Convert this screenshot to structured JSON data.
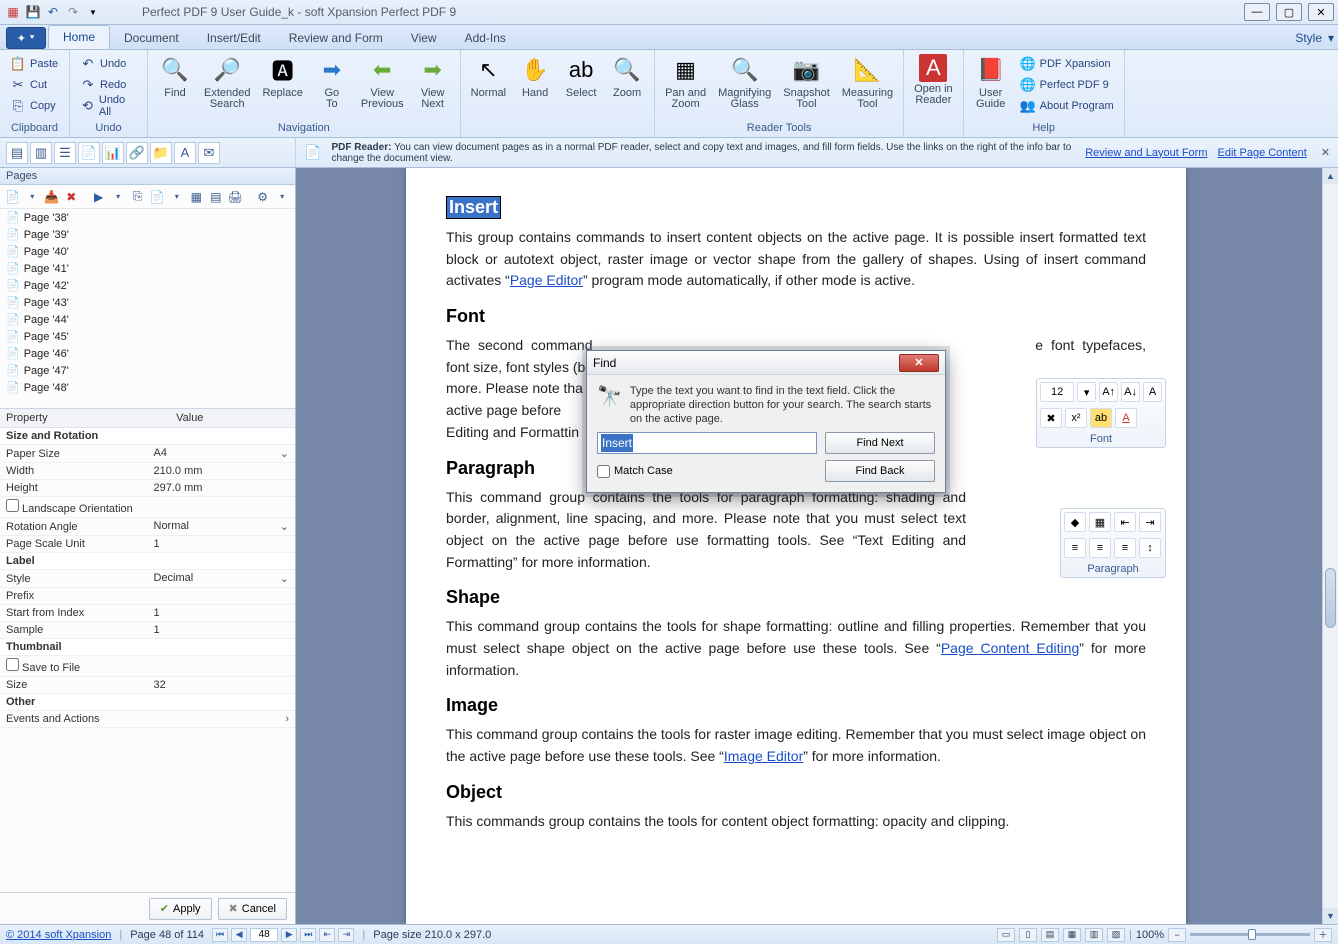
{
  "title": "Perfect PDF 9 User Guide_k - soft Xpansion Perfect PDF 9",
  "tabs": [
    "Home",
    "Document",
    "Insert/Edit",
    "Review and Form",
    "View",
    "Add-Ins"
  ],
  "active_tab": 0,
  "style_menu": "Style",
  "ribbon": {
    "clipboard": {
      "label": "Clipboard",
      "paste": "Paste",
      "cut": "Cut",
      "copy": "Copy"
    },
    "undo": {
      "label": "Undo",
      "undo": "Undo",
      "redo": "Redo",
      "undo_all": "Undo All"
    },
    "navigation": {
      "label": "Navigation",
      "find": "Find",
      "ext": "Extended\nSearch",
      "replace": "Replace",
      "goto": "Go\nTo",
      "vprev": "View\nPrevious",
      "vnext": "View\nNext"
    },
    "tools": {
      "normal": "Normal",
      "hand": "Hand",
      "select": "Select",
      "zoom": "Zoom"
    },
    "reader": {
      "label": "Reader Tools",
      "pan": "Pan and\nZoom",
      "mag": "Magnifying\nGlass",
      "snap": "Snapshot\nTool",
      "meas": "Measuring\nTool"
    },
    "open_reader": "Open in\nReader",
    "user_guide": "User\nGuide",
    "help": {
      "label": "Help",
      "xp": "PDF Xpansion",
      "p9": "Perfect PDF 9",
      "about": "About Program"
    }
  },
  "infobar": {
    "title": "PDF Reader:",
    "text": "You can view document pages as in a normal PDF reader, select and copy text and images, and fill form fields. Use the links on the right of the info bar to change the document view.",
    "link1": "Review and Layout Form",
    "link2": "Edit Page Content"
  },
  "pages_panel": {
    "title": "Pages",
    "items": [
      "Page '38'",
      "Page '39'",
      "Page '40'",
      "Page '41'",
      "Page '42'",
      "Page '43'",
      "Page '44'",
      "Page '45'",
      "Page '46'",
      "Page '47'",
      "Page '48'"
    ]
  },
  "props": {
    "headers": [
      "Property",
      "Value"
    ],
    "groups": [
      {
        "name": "Size and Rotation",
        "rows": [
          [
            "Paper Size",
            "A4",
            "dd"
          ],
          [
            "Width",
            "210.0 mm",
            ""
          ],
          [
            "Height",
            "297.0 mm",
            ""
          ],
          [
            "Landscape Orientation",
            "",
            "chk"
          ],
          [
            "Rotation Angle",
            "Normal",
            "dd"
          ],
          [
            "Page Scale Unit",
            "1",
            ""
          ]
        ]
      },
      {
        "name": "Label",
        "rows": [
          [
            "Style",
            "Decimal",
            "dd"
          ],
          [
            "Prefix",
            "",
            ""
          ],
          [
            "Start from Index",
            "1",
            ""
          ],
          [
            "Sample",
            "1",
            ""
          ]
        ]
      },
      {
        "name": "Thumbnail",
        "rows": [
          [
            "Save to File",
            "",
            "chk"
          ],
          [
            "Size",
            "32",
            ""
          ]
        ]
      },
      {
        "name": "Other",
        "rows": [
          [
            "Events and Actions",
            "",
            "arr"
          ]
        ]
      }
    ],
    "apply": "Apply",
    "cancel": "Cancel"
  },
  "doc": {
    "h1": "Insert",
    "p1a": "This group contains commands to insert content objects on the active page. It is possible insert formatted text block or autotext object, raster image or vector shape from the gallery of shapes. Using of insert command activates “",
    "p1_link": "Page Editor",
    "p1b": "” program mode automatically, if other mode is active.",
    "h2": "Font",
    "p2a": "The second command",
    "p2b": "e font typefaces, font size, font styles (bol",
    "p2c": "more. Please note tha",
    "p2d": "active page before",
    "p2e": "Editing and Formattin",
    "font_box_label": "Font",
    "font_size": "12",
    "h3": "Paragraph",
    "p3": "This command group contains the tools for paragraph formatting: shading and border, alignment, line spacing, and more. Please note that you must select text object on the active page before use formatting tools. See “Text Editing and Formatting” for more information.",
    "para_box_label": "Paragraph",
    "h4": "Shape",
    "p4a": "This command group contains the tools for shape formatting: outline and filling properties. Remember that you must select shape object on the active page before use these tools. See “",
    "p4_link": "Page Content Editing",
    "p4b": "” for more information.",
    "h5": "Image",
    "p5a": "This command group contains the tools for raster image editing. Remember that you must select image object on the active page before use these tools. See “",
    "p5_link": "Image Editor",
    "p5b": "” for more information.",
    "h6": "Object",
    "p6": "This commands group contains the tools for content object formatting: opacity and clipping."
  },
  "dialog": {
    "title": "Find",
    "hint": "Type the text you want to find in the text field. Click the appropriate direction button for your search. The search starts on the active page.",
    "value": "Insert",
    "match_case": "Match Case",
    "find_next": "Find Next",
    "find_back": "Find Back"
  },
  "status": {
    "copyright": "© 2014 soft Xpansion",
    "page_label": "Page 48 of 114",
    "page_num": "48",
    "page_size": "Page size 210.0 x 297.0",
    "zoom": "100%"
  }
}
